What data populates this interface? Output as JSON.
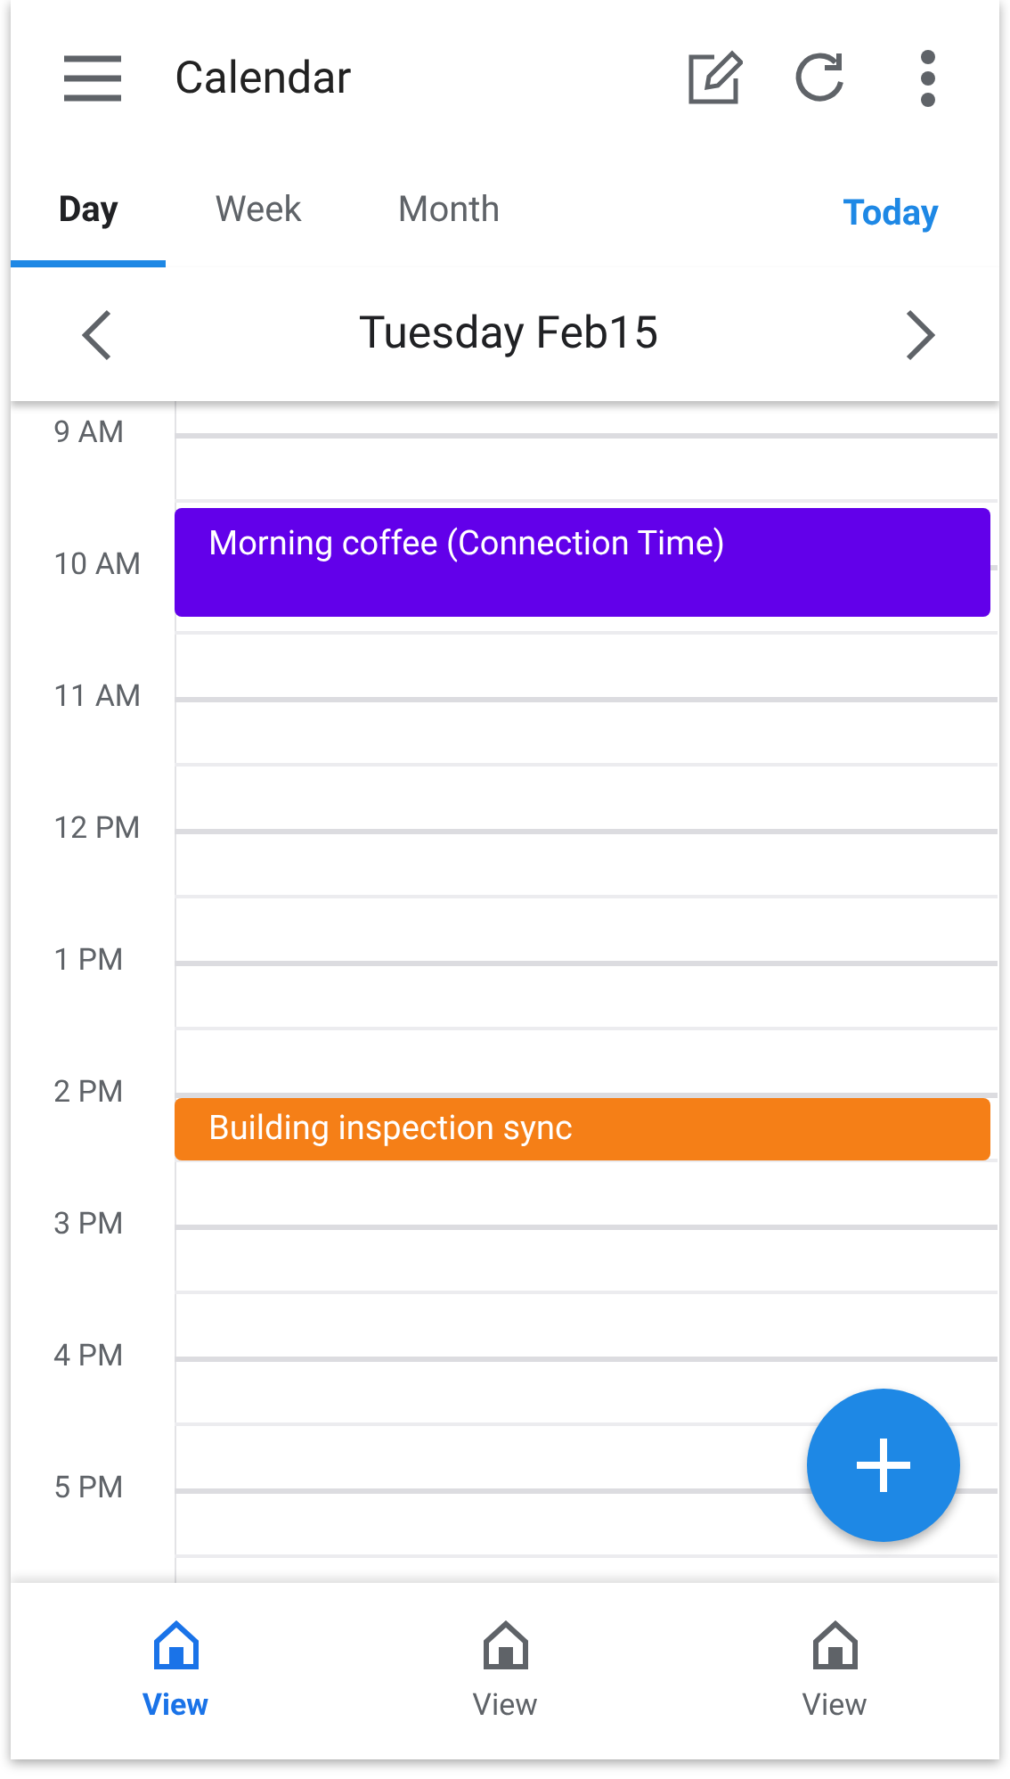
{
  "app_bar": {
    "title": "Calendar"
  },
  "tabs": [
    {
      "label": "Day",
      "selected": true
    },
    {
      "label": "Week",
      "selected": false
    },
    {
      "label": "Month",
      "selected": false
    }
  ],
  "today_button": "Today",
  "date_header": {
    "date": "Tuesday Feb15"
  },
  "hours": [
    {
      "label": "9 AM",
      "events": [
        {
          "title": "Morning coffee (Connection Time)",
          "color": "#6200ea",
          "kind": "long"
        }
      ]
    },
    {
      "label": "10 AM"
    },
    {
      "label": "11 AM"
    },
    {
      "label": "12 PM"
    },
    {
      "label": "1 PM"
    },
    {
      "label": "2 PM",
      "events": [
        {
          "title": "Building inspection sync",
          "color": "#f57f17",
          "kind": "short"
        }
      ]
    },
    {
      "label": "3 PM"
    },
    {
      "label": "4 PM"
    },
    {
      "label": "5 PM"
    }
  ],
  "bottom_nav": [
    {
      "label": "View",
      "selected": true
    },
    {
      "label": "View",
      "selected": false
    },
    {
      "label": "View",
      "selected": false
    }
  ]
}
